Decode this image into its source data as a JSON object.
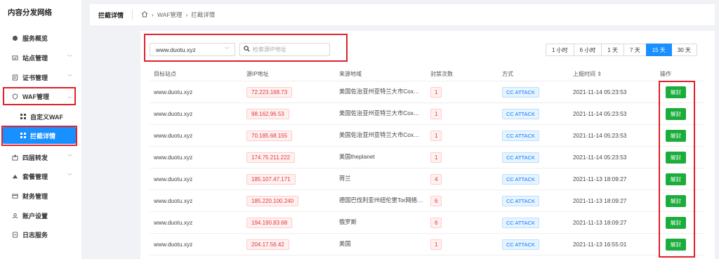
{
  "sidebar": {
    "brand": "内容分发网络",
    "items": [
      {
        "label": "服务概览",
        "icon": "dashboard-icon",
        "chevron": false
      },
      {
        "label": "站点管理",
        "icon": "site-icon",
        "chevron": true
      },
      {
        "label": "证书管理",
        "icon": "certificate-icon",
        "chevron": true
      },
      {
        "label": "WAF管理",
        "icon": "shield-icon",
        "chevron": true
      },
      {
        "label": "自定义WAF",
        "icon": "grid-icon",
        "chevron": false
      },
      {
        "label": "拦截详情",
        "icon": "grid-icon",
        "chevron": false
      },
      {
        "label": "四层转发",
        "icon": "forward-icon",
        "chevron": true
      },
      {
        "label": "套餐管理",
        "icon": "package-icon",
        "chevron": true
      },
      {
        "label": "财务管理",
        "icon": "finance-icon",
        "chevron": false
      },
      {
        "label": "账户设置",
        "icon": "user-icon",
        "chevron": false
      },
      {
        "label": "日志服务",
        "icon": "log-icon",
        "chevron": false
      }
    ]
  },
  "header": {
    "title": "拦截详情",
    "breadcrumb": [
      "WAF管理",
      "拦截详情"
    ]
  },
  "filters": {
    "domain": "www.duotu.xyz",
    "search_placeholder": "检索源IP地址"
  },
  "time_ranges": [
    "1 小时",
    "6 小时",
    "1 天",
    "7 天",
    "15 天",
    "30 天"
  ],
  "active_range": "15 天",
  "table": {
    "headers": [
      "目标站点",
      "源IP地址",
      "来源地域",
      "封禁次数",
      "方式",
      "上报时间 ⇕",
      "操作"
    ],
    "rows": [
      {
        "site": "www.duotu.xyz",
        "ip": "72.223.168.73",
        "region": "美国佐治亚州亚特兰大市Cox通信公...",
        "count": "1",
        "method": "CC ATTACK",
        "time": "2021-11-14 05:23:53",
        "action": "解封"
      },
      {
        "site": "www.duotu.xyz",
        "ip": "98.162.96.53",
        "region": "美国佐治亚州亚特兰大市Cox通信公...",
        "count": "1",
        "method": "CC ATTACK",
        "time": "2021-11-14 05:23:53",
        "action": "解封"
      },
      {
        "site": "www.duotu.xyz",
        "ip": "70.185.68.155",
        "region": "美国佐治亚州亚特兰大市Cox通信公...",
        "count": "1",
        "method": "CC ATTACK",
        "time": "2021-11-14 05:23:53",
        "action": "解封"
      },
      {
        "site": "www.duotu.xyz",
        "ip": "174.75.211.222",
        "region": "美国theplanet",
        "count": "1",
        "method": "CC ATTACK",
        "time": "2021-11-14 05:23:53",
        "action": "解封"
      },
      {
        "site": "www.duotu.xyz",
        "ip": "185.107.47.171",
        "region": "荷兰",
        "count": "4",
        "method": "CC ATTACK",
        "time": "2021-11-13 18:09:27",
        "action": "解封"
      },
      {
        "site": "www.duotu.xyz",
        "ip": "185.220.100.240",
        "region": "德国巴伐利亚州纽伦堡Tor网络出口",
        "count": "6",
        "method": "CC ATTACK",
        "time": "2021-11-13 18:09:27",
        "action": "解封"
      },
      {
        "site": "www.duotu.xyz",
        "ip": "194.190.83.68",
        "region": "俄罗斯",
        "count": "6",
        "method": "CC ATTACK",
        "time": "2021-11-13 18:09:27",
        "action": "解封"
      },
      {
        "site": "www.duotu.xyz",
        "ip": "204.17.56.42",
        "region": "美国",
        "count": "1",
        "method": "CC ATTACK",
        "time": "2021-11-13 16:55:01",
        "action": "解封"
      }
    ]
  },
  "colors": {
    "accent": "#1890ff",
    "danger": "#e0202a",
    "success": "#1aad3c"
  }
}
